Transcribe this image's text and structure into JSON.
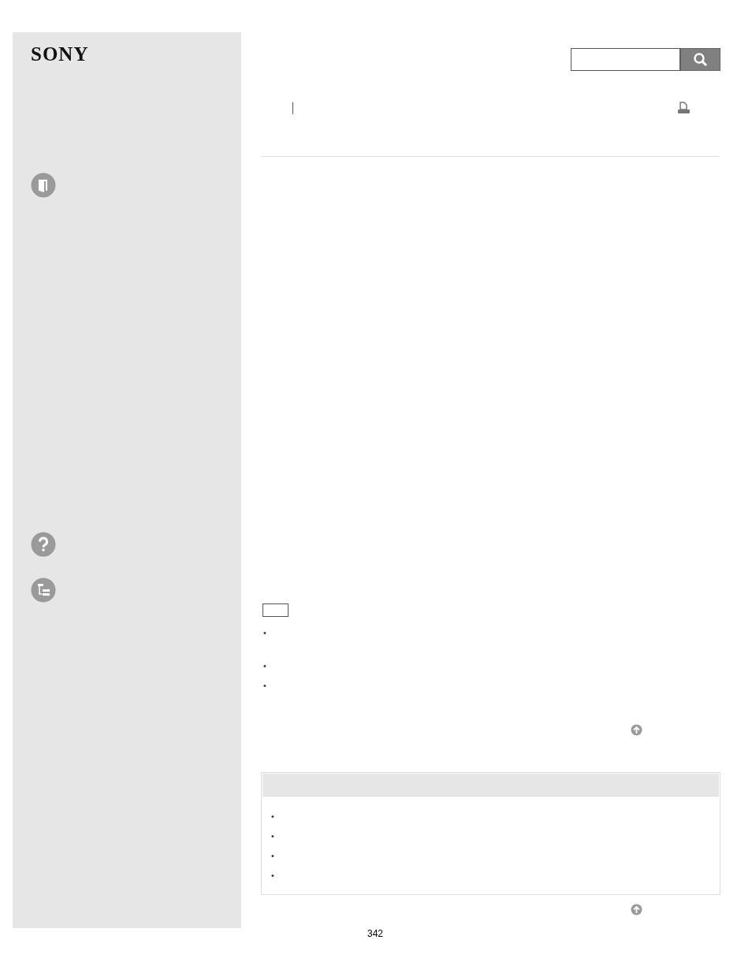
{
  "sidebar": {
    "logo": "SONY"
  },
  "note": {
    "bullets": [
      "•",
      "•",
      "•"
    ]
  },
  "related": {
    "bullets": [
      "•",
      "•",
      "•",
      "•"
    ]
  },
  "page_number": "342"
}
